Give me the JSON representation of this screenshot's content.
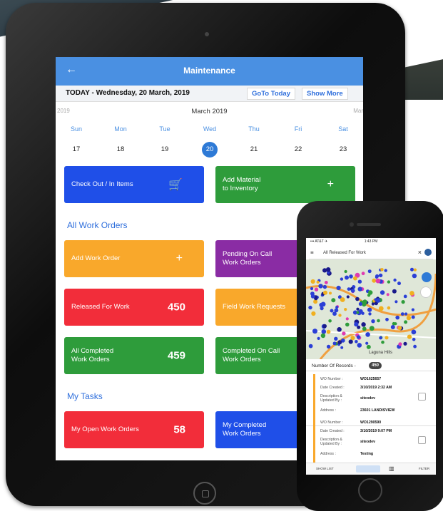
{
  "tablet": {
    "appbar": {
      "title": "Maintenance",
      "back_icon": "←"
    },
    "datebar": {
      "today": "TODAY - Wednesday, 20 March, 2019",
      "goto": "GoTo Today",
      "more": "Show More"
    },
    "calendar": {
      "prev_year": "2019",
      "next_year": "Marc",
      "month": "March 2019",
      "days": [
        "Sun",
        "Mon",
        "Tue",
        "Wed",
        "Thu",
        "Fri",
        "Sat"
      ],
      "dates": [
        "17",
        "18",
        "19",
        "20",
        "21",
        "22",
        "23"
      ],
      "selected": "20"
    },
    "actions": {
      "checkout": "Check Out / In Items",
      "checkout_icon": "🛒",
      "add_material": "Add Material\nto Inventory",
      "add_material_icon": "+"
    },
    "work_orders": {
      "heading": "All Work Orders",
      "add": "Add Work Order",
      "add_icon": "+",
      "pending": "Pending On Call\nWork Orders",
      "released": "Released For Work",
      "released_count": "450",
      "field": "Field Work Requests",
      "completed": "All Completed\nWork Orders",
      "completed_count": "459",
      "completed_oncall": "Completed On Call\nWork Orders"
    },
    "tasks": {
      "heading": "My Tasks",
      "open": "My Open Work Orders",
      "open_count": "58",
      "completed": "My Completed\nWork Orders"
    }
  },
  "phone": {
    "status_left": "••• AT&T ✈",
    "status_time": "1:43 PM",
    "search": "All Released For Work",
    "close_icon": "×",
    "map_place": "Laguna Hills",
    "records_label": "Number Of Records -",
    "records_count": "450",
    "rows": [
      {
        "wo_label": "WO Number :",
        "wo": "WO1625657",
        "date_label": "Date Created :",
        "date": "3/10/2019 2:32 AM",
        "desc_label": "Description & Updated By :",
        "desc": "siteodev",
        "addr_label": "Address :",
        "addr": "23601 LANDISVIEW"
      },
      {
        "wo_label": "WO Number :",
        "wo": "WO1290590",
        "date_label": "Date Created :",
        "date": "3/10/2019 9:07 PM",
        "desc_label": "Description & Updated By :",
        "desc": "siteodev",
        "addr_label": "Address :",
        "addr": "Testing"
      }
    ],
    "nav": [
      "SHOW LIST",
      "",
      "",
      "FILTER"
    ]
  }
}
